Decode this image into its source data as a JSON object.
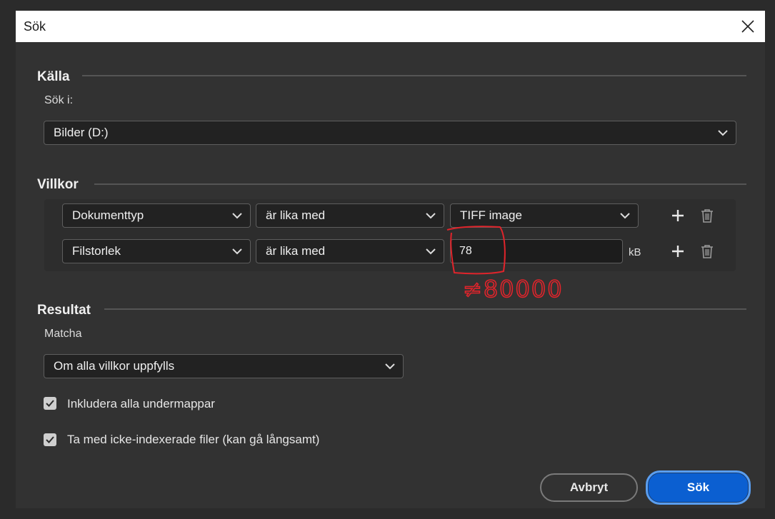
{
  "window": {
    "title": "Sök"
  },
  "source": {
    "heading": "Källa",
    "search_in_label": "Sök i:",
    "search_in_value": "Bilder (D:)"
  },
  "conditions": {
    "heading": "Villkor",
    "rows": [
      {
        "field": "Dokumenttyp",
        "operator": "är lika med",
        "value": "TIFF image"
      },
      {
        "field": "Filstorlek",
        "operator": "är lika med",
        "value": "78",
        "unit": "kB"
      }
    ]
  },
  "results": {
    "heading": "Resultat",
    "match_label": "Matcha",
    "match_value": "Om alla villkor uppfylls",
    "checkboxes": [
      {
        "label": "Inkludera alla undermappar",
        "checked": true
      },
      {
        "label": "Ta med icke-indexerade filer (kan gå långsamt)",
        "checked": true
      }
    ]
  },
  "buttons": {
    "cancel": "Avbryt",
    "search": "Sök"
  },
  "annotation": {
    "text": "≠80000",
    "color": "#e0242b"
  },
  "colors": {
    "accent": "#0b5fd1",
    "focus_ring": "#5a9ef0"
  }
}
